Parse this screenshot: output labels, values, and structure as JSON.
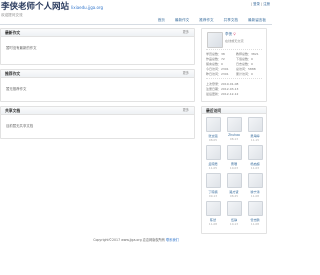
{
  "topbar": {
    "links": [
      "登录",
      "注册"
    ],
    "sep": "|"
  },
  "header": {
    "title": "李侠老师个人网站",
    "url": "lixiaedu.jjga.org",
    "subtitle": "欢迎提问交流"
  },
  "nav": {
    "items": [
      "首页",
      "最新作文",
      "推荐作文",
      "共享文档",
      "最新留言板"
    ]
  },
  "panels": [
    {
      "title": "最新作文",
      "more": "更多",
      "empty": "暂时没有最新的作文"
    },
    {
      "title": "推荐作文",
      "more": "更多",
      "empty": "暂无推荐作文"
    },
    {
      "title": "共享文档",
      "more": "更多",
      "empty": "目前暂无共享文档"
    }
  ],
  "profile": {
    "name": "李侠",
    "gender_icon": "♀",
    "status": "在线或无交流",
    "stats": [
      "学员总数：38",
      "教师总数：3821",
      "作品总数：72",
      "下载总数：0",
      "留言总数：0",
      "日志总数：0",
      "今日访问：2301",
      "总访问：5888",
      "昨日访问：2301",
      "累计访问：0"
    ],
    "dates": [
      "上次登录：2019-01-08",
      "注册日期：2012-03-13",
      "最后更新：2012-12-12"
    ]
  },
  "visitors": {
    "title": "最近访问",
    "items": [
      {
        "name": "张文强",
        "time": "08-05"
      },
      {
        "name": "Zhuhao",
        "time": "08-13"
      },
      {
        "name": "吴海婷",
        "time": "11-15"
      },
      {
        "name": "孟晓霞",
        "time": "11-05"
      },
      {
        "name": "曹珊",
        "time": "10-03"
      },
      {
        "name": "杨启超",
        "time": "11-03"
      },
      {
        "name": "丁晓楠",
        "time": "09-13"
      },
      {
        "name": "路方贤",
        "time": "08-25"
      },
      {
        "name": "徐宁涛",
        "time": "11-08"
      },
      {
        "name": "陈然",
        "time": "11-08"
      },
      {
        "name": "伍静",
        "time": "10-13"
      },
      {
        "name": "曾志鹏",
        "time": "11-08"
      }
    ]
  },
  "footer": {
    "text": "Copyright©2017 www.jjga.org 嘉嘉网版权所有",
    "link": "联系我们"
  }
}
